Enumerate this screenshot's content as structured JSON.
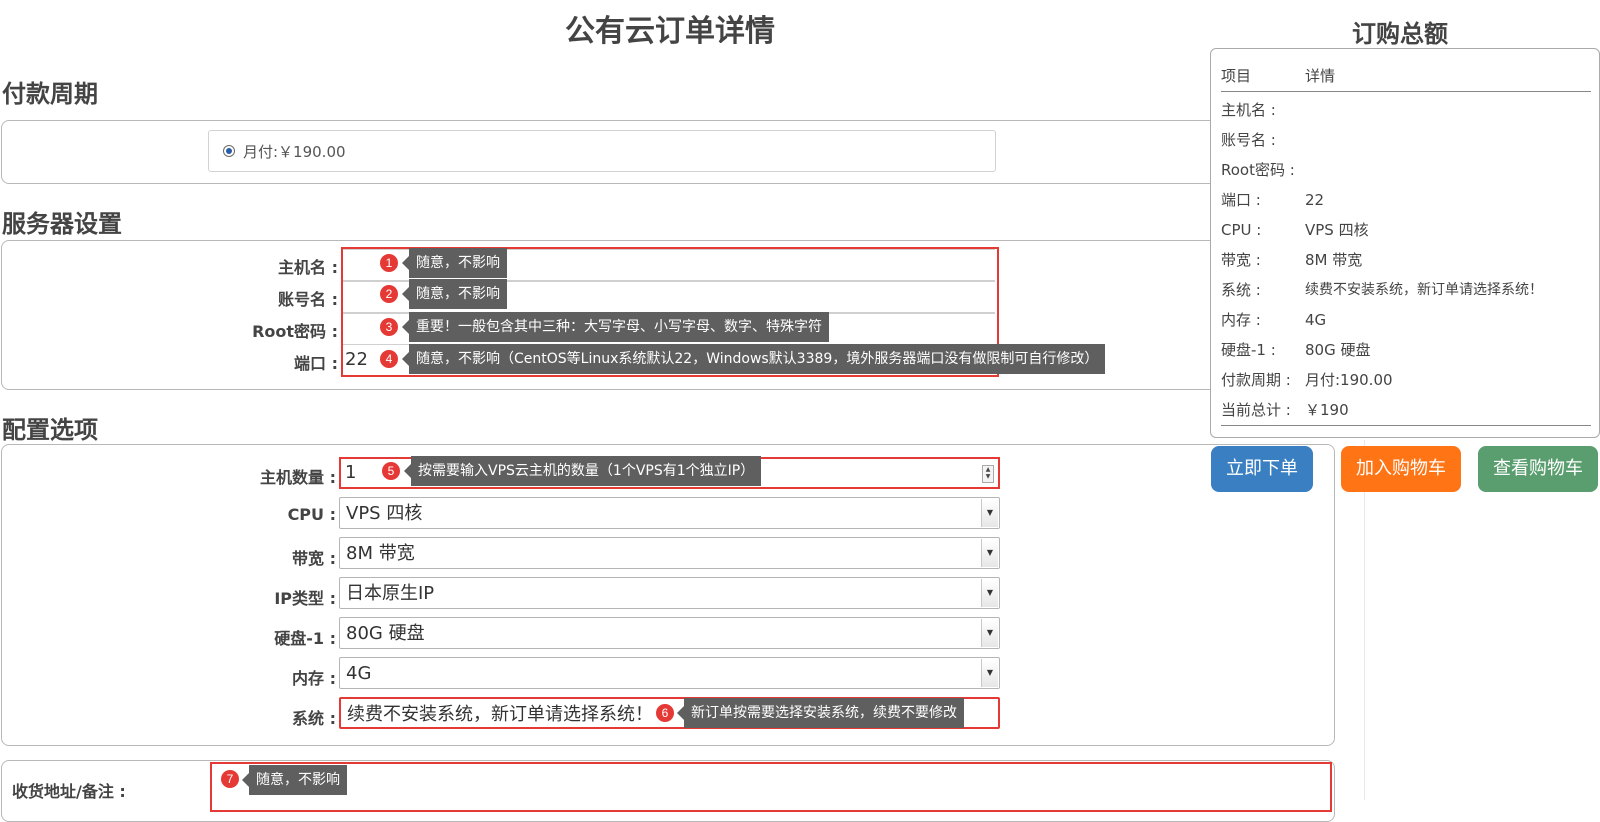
{
  "page_title": "公有云订单详情",
  "payment": {
    "section_title": "付款周期",
    "option_label": "月付:￥190.00"
  },
  "server": {
    "section_title": "服务器设置",
    "fields": [
      {
        "label": "主机名 :",
        "value": "",
        "badge": "1",
        "tip": "随意，不影响"
      },
      {
        "label": "账号名 :",
        "value": "",
        "badge": "2",
        "tip": "随意，不影响"
      },
      {
        "label": "Root密码 :",
        "value": "",
        "badge": "3",
        "tip": "重要！一般包含其中三种：大写字母、小写字母、数字、特殊字符"
      },
      {
        "label": "端口 :",
        "value": "22",
        "badge": "4",
        "tip": "随意，不影响（CentOS等Linux系统默认22，Windows默认3389，境外服务器端口没有做限制可自行修改）"
      }
    ]
  },
  "config": {
    "section_title": "配置选项",
    "qty": {
      "label": "主机数量 :",
      "value": "1",
      "badge": "5",
      "tip": "按需要输入VPS云主机的数量（1个VPS有1个独立IP）"
    },
    "selects": [
      {
        "label": "CPU :",
        "value": "VPS 四核"
      },
      {
        "label": "带宽 :",
        "value": "8M 带宽"
      },
      {
        "label": "IP类型 :",
        "value": "日本原生IP"
      },
      {
        "label": "硬盘-1 :",
        "value": "80G 硬盘"
      },
      {
        "label": "内存 :",
        "value": "4G"
      }
    ],
    "system": {
      "label": "系统 :",
      "value": "续费不安装系统，新订单请选择系统！",
      "badge": "6",
      "tip": "新订单按需要选择安装系统，续费不要修改"
    }
  },
  "notes": {
    "label": "收货地址/备注 :",
    "badge": "7",
    "tip": "随意，不影响"
  },
  "summary": {
    "title": "订购总额",
    "header": {
      "k": "项目",
      "v": "详情"
    },
    "rows": [
      {
        "k": "主机名 :",
        "v": ""
      },
      {
        "k": "账号名 :",
        "v": ""
      },
      {
        "k": "Root密码 :",
        "v": ""
      },
      {
        "k": "端口 :",
        "v": "22"
      },
      {
        "k": "CPU :",
        "v": "VPS 四核"
      },
      {
        "k": "带宽 :",
        "v": "8M 带宽"
      },
      {
        "k": "系统 :",
        "v": "续费不安装系统，新订单请选择系统！"
      },
      {
        "k": "内存 :",
        "v": "4G"
      },
      {
        "k": "硬盘-1 :",
        "v": "80G 硬盘"
      },
      {
        "k": "付款周期 :",
        "v": "月付:190.00"
      },
      {
        "k": "当前总计 :",
        "v": "￥190"
      }
    ]
  },
  "buttons": {
    "order": "立即下单",
    "add_cart": "加入购物车",
    "view_cart": "查看购物车"
  },
  "colors": {
    "order_btn": "#3a7fc1",
    "add_cart_btn": "#ff7415",
    "view_cart_btn": "#5a9e6f",
    "highlight": "#e53935",
    "tooltip": "#5f5f5f"
  }
}
